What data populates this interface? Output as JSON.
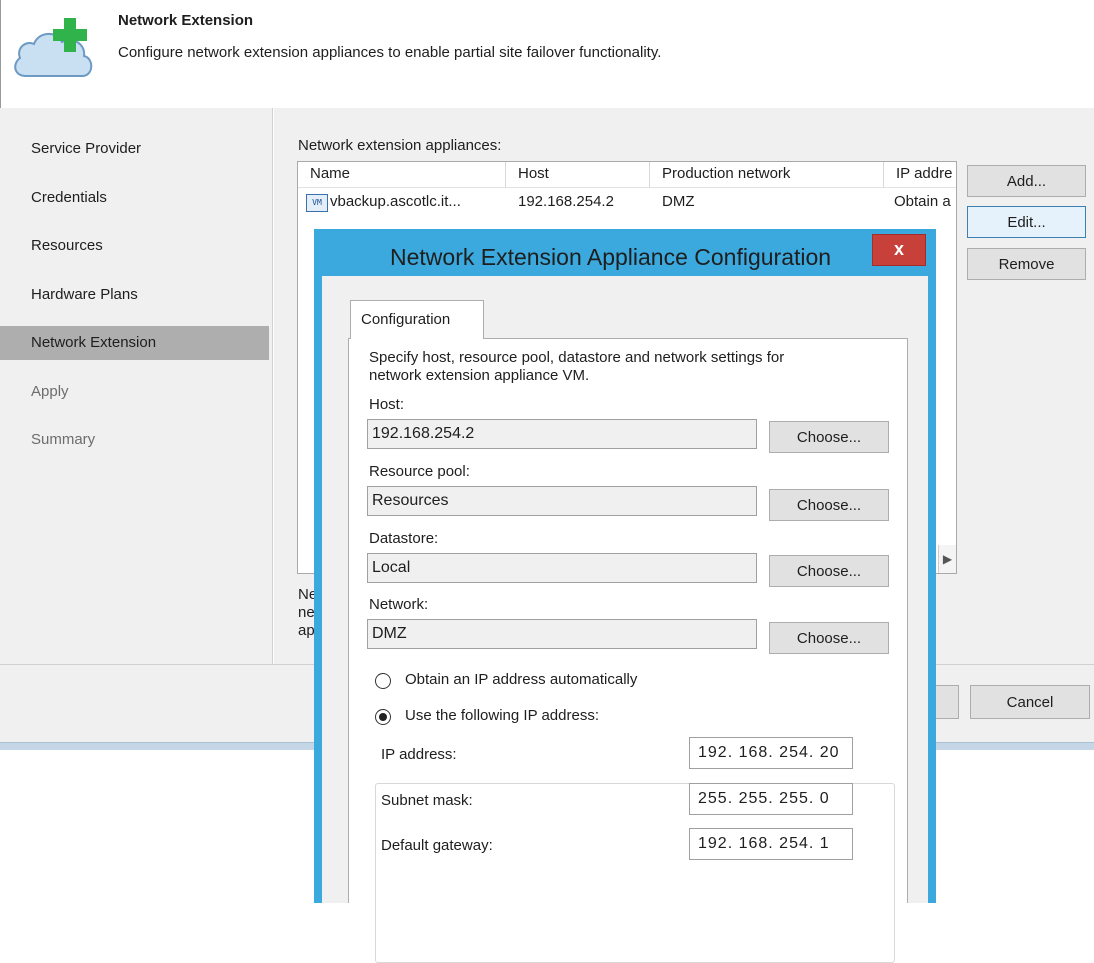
{
  "header": {
    "title": "Network Extension",
    "description": "Configure network extension appliances to enable partial site failover functionality.",
    "icon": "cloud-plus-icon"
  },
  "nav": {
    "items": [
      {
        "label": "Service Provider",
        "state": "normal"
      },
      {
        "label": "Credentials",
        "state": "normal"
      },
      {
        "label": "Resources",
        "state": "normal"
      },
      {
        "label": "Hardware Plans",
        "state": "normal"
      },
      {
        "label": "Network Extension",
        "state": "active"
      },
      {
        "label": "Apply",
        "state": "disabled"
      },
      {
        "label": "Summary",
        "state": "disabled"
      }
    ]
  },
  "appliances": {
    "label": "Network extension appliances:",
    "columns": [
      "Name",
      "Host",
      "Production network",
      "IP addre"
    ],
    "rows": [
      {
        "name": "vbackup.ascotlc.it...",
        "host": "192.168.254.2",
        "network": "DMZ",
        "ip": "Obtain a",
        "icon": "vm-icon"
      }
    ],
    "buttons": {
      "add": "Add...",
      "edit": "Edit...",
      "remove": "Remove"
    }
  },
  "bottom_text": [
    "Ne",
    "ne",
    "ap"
  ],
  "footer": {
    "cancel": "Cancel"
  },
  "dialog": {
    "title": "Network Extension Appliance Configuration",
    "close": "x",
    "tab": "Configuration",
    "description_line1": "Specify host, resource pool, datastore and network settings for",
    "description_line2": "network extension appliance VM.",
    "host_label": "Host:",
    "host_value": "192.168.254.2",
    "pool_label": "Resource pool:",
    "pool_value": "Resources",
    "datastore_label": "Datastore:",
    "datastore_value": "Local",
    "network_label": "Network:",
    "network_value": "DMZ",
    "choose": "Choose...",
    "radio_auto": "Obtain an IP address automatically",
    "radio_manual": "Use the following IP address:",
    "ip_label": "IP address:",
    "ip_value": "192. 168. 254. 20",
    "mask_label": "Subnet mask:",
    "mask_value": "255. 255. 255. 0",
    "gateway_label": "Default gateway:",
    "gateway_value": "192. 168. 254. 1",
    "selected_radio": "manual"
  },
  "colors": {
    "dialog_border": "#3ba9de",
    "close_button": "#c7403a",
    "nav_active": "#aeaeae",
    "icon_green": "#2fb34a"
  }
}
